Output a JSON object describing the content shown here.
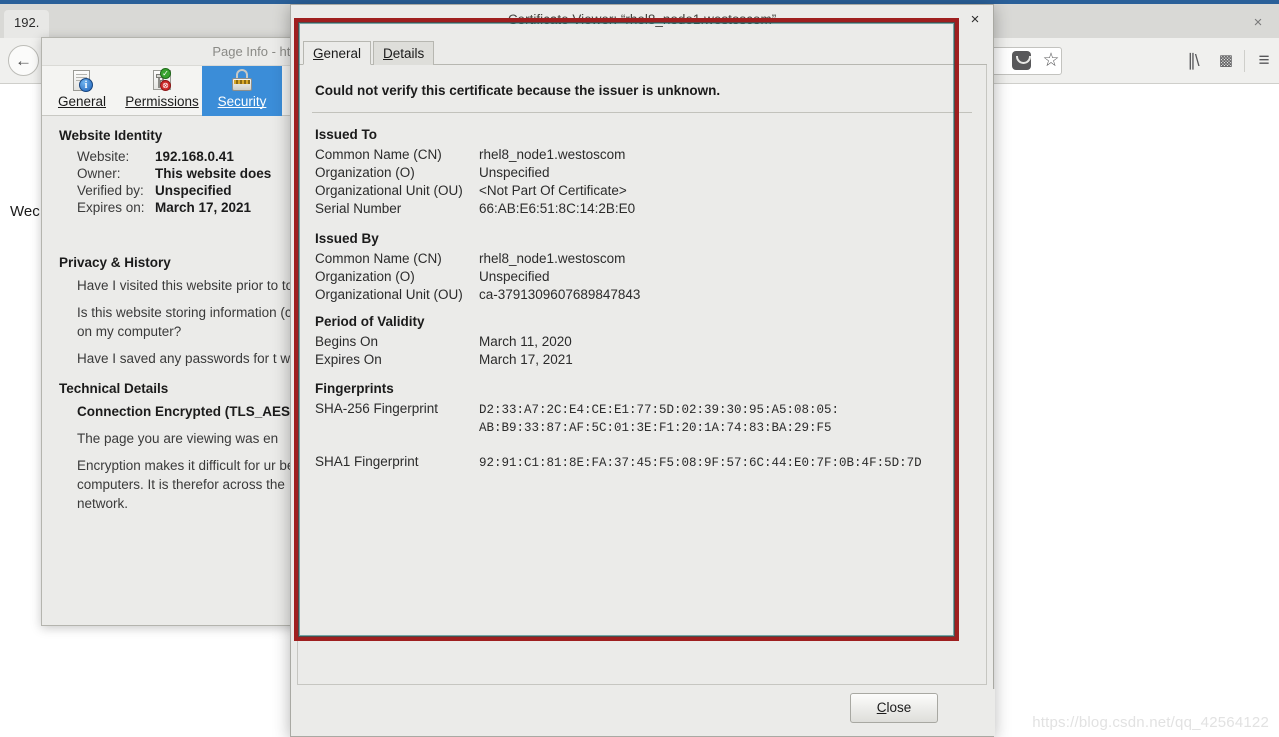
{
  "browser": {
    "tab_label": "192.",
    "back_icon": "back-arrow-icon",
    "page_text": "Wec",
    "window_close_label": "×",
    "toolbar_icons": [
      {
        "name": "pocket-icon",
        "glyph": ""
      },
      {
        "name": "bookmark-star-icon",
        "glyph": "☆"
      },
      {
        "name": "library-icon",
        "glyph": "⦀"
      },
      {
        "name": "sidebar-icon",
        "glyph": "▣"
      },
      {
        "name": "hamburger-menu-icon",
        "glyph": "≡"
      }
    ]
  },
  "page_info": {
    "title": "Page Info - htt",
    "tabs": [
      {
        "label": "General",
        "icon": "document-info-icon",
        "active": false
      },
      {
        "label": "Permissions",
        "icon": "sliders-permissions-icon",
        "active": false
      },
      {
        "label": "Security",
        "icon": "padlock-icon",
        "active": true
      }
    ],
    "website_identity": {
      "heading": "Website Identity",
      "rows": [
        {
          "label": "Website:",
          "value": "192.168.0.41"
        },
        {
          "label": "Owner:",
          "value": "This website does"
        },
        {
          "label": "Verified by:",
          "value": "Unspecified"
        },
        {
          "label": "Expires on:",
          "value": "March 17, 2021"
        }
      ]
    },
    "privacy_history": {
      "heading": "Privacy & History",
      "items": [
        "Have I visited this website prior to today?",
        "Is this website storing information (cookies) on my computer?",
        "Have I saved any passwords for t website?"
      ]
    },
    "technical_details": {
      "heading": "Technical Details",
      "connection": "Connection Encrypted (TLS_AES",
      "items": [
        "The page you are viewing was en",
        "Encryption makes it difficult for ur between computers. It is therefor across the network."
      ]
    }
  },
  "cert_dialog": {
    "title": "Certificate Viewer: “rhel8_node1.westoscom”",
    "close_icon_label": "×",
    "tabs": [
      {
        "label_pre": "",
        "accel": "G",
        "label_post": "eneral",
        "active": true
      },
      {
        "label_pre": "",
        "accel": "D",
        "label_post": "etails",
        "active": false
      }
    ],
    "warning": "Could not verify this certificate because the issuer is unknown.",
    "groups": [
      {
        "title": "Issued To",
        "rows": [
          {
            "label": "Common Name (CN)",
            "value": "rhel8_node1.westoscom",
            "mono": false
          },
          {
            "label": "Organization (O)",
            "value": "Unspecified",
            "mono": false
          },
          {
            "label": "Organizational Unit (OU)",
            "value": "<Not Part Of Certificate>",
            "mono": false
          },
          {
            "label": "Serial Number",
            "value": "66:AB:E6:51:8C:14:2B:E0",
            "mono": false
          }
        ]
      },
      {
        "title": "Issued By",
        "rows": [
          {
            "label": "Common Name (CN)",
            "value": "rhel8_node1.westoscom",
            "mono": false
          },
          {
            "label": "Organization (O)",
            "value": "Unspecified",
            "mono": false
          },
          {
            "label": "Organizational Unit (OU)",
            "value": "ca-3791309607689847843",
            "mono": false
          }
        ]
      },
      {
        "title": "Period of Validity",
        "rows": [
          {
            "label": "Begins On",
            "value": "March 11, 2020",
            "mono": false
          },
          {
            "label": "Expires On",
            "value": "March 17, 2021",
            "mono": false
          }
        ]
      },
      {
        "title": "Fingerprints",
        "rows": [
          {
            "label": "SHA-256 Fingerprint",
            "value": "D2:33:A7:2C:E4:CE:E1:77:5D:02:39:30:95:A5:08:05:\nAB:B9:33:87:AF:5C:01:3E:F1:20:1A:74:83:BA:29:F5",
            "mono": true
          },
          {
            "label": "SHA1 Fingerprint",
            "value": "92:91:C1:81:8E:FA:37:45:F5:08:9F:57:6C:44:E0:7F:0B:4F:5D:7D",
            "mono": true
          }
        ]
      }
    ],
    "close_button": {
      "accel": "C",
      "label_post": "lose"
    }
  },
  "annotation": {
    "border_color": "#9e1f1f"
  },
  "watermark": "https://blog.csdn.net/qq_42564122"
}
